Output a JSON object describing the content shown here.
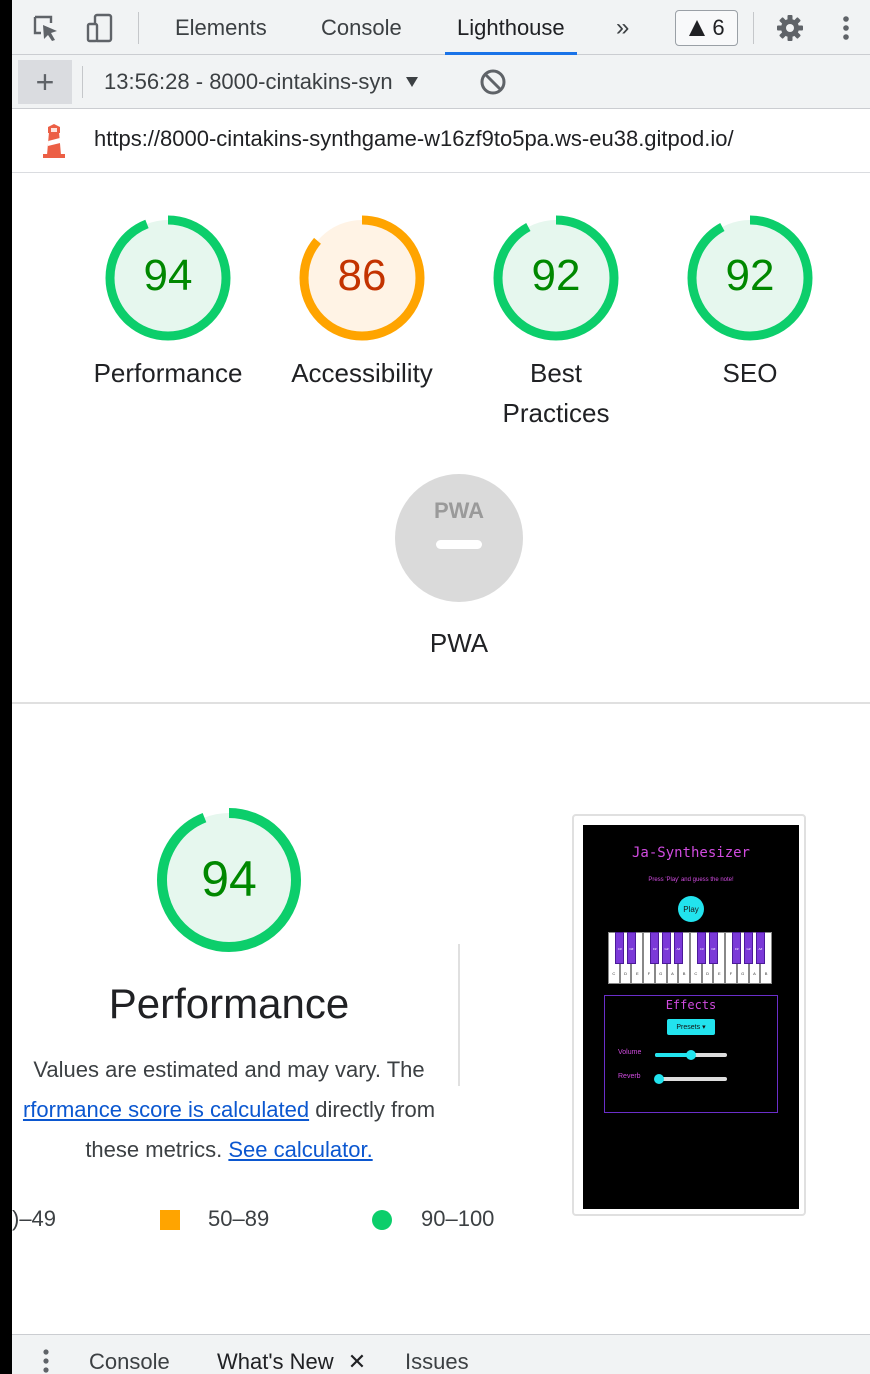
{
  "toolbar": {
    "tabs": [
      {
        "label": "Elements"
      },
      {
        "label": "Console"
      },
      {
        "label": "Lighthouse",
        "active": true
      }
    ],
    "overflow_icon": "chevron-double-right-icon",
    "warnings_count": "6",
    "settings_icon": "gear-icon",
    "more_icon": "vertical-dots-icon"
  },
  "toolbar2": {
    "new_report_label": "+",
    "report_select": "13:56:28 - 8000-cintakins-syn",
    "clear_icon": "block-icon"
  },
  "url_bar": {
    "icon": "lighthouse-icon",
    "url": "https://8000-cintakins-synthgame-w16zf9to5pa.ws-eu38.gitpod.io/"
  },
  "scores": [
    {
      "label": "Performance",
      "value": "94",
      "fraction": 0.94,
      "status": "pass"
    },
    {
      "label": "Accessibility",
      "value": "86",
      "fraction": 0.86,
      "status": "average"
    },
    {
      "label": "Best Practices",
      "line1": "Best",
      "line2": "Practices",
      "value": "92",
      "fraction": 0.92,
      "status": "pass"
    },
    {
      "label": "SEO",
      "value": "92",
      "fraction": 0.92,
      "status": "pass"
    }
  ],
  "pwa": {
    "badge": "PWA",
    "label": "PWA"
  },
  "performance": {
    "score": "94",
    "fraction": 0.94,
    "title": "Performance",
    "desc_part1": "Values are estimated and may vary. The",
    "desc_link1": "rformance score is calculated",
    "desc_part2": "directly from",
    "desc_part3": "these metrics.",
    "desc_link2": "See calculator."
  },
  "legend": {
    "fail_range": ")–49",
    "average_range": "50–89",
    "pass_range": "90–100"
  },
  "screenshot": {
    "title": "Ja-Synthesizer",
    "subtitle": "Press 'Play' and guess the note!",
    "play_label": "Play",
    "white_keys": [
      "C",
      "D",
      "E",
      "F",
      "G",
      "A",
      "B"
    ],
    "black_keys": [
      "C#",
      "D#",
      "F#",
      "G#",
      "A#"
    ],
    "effects_title": "Effects",
    "presets_label": "Presets ▾",
    "volume_label": "Volume",
    "volume_level": 0.5,
    "reverb_label": "Reverb",
    "reverb_level": 0.05
  },
  "drawer": {
    "more_icon": "vertical-dots-icon",
    "tabs": [
      {
        "label": "Console"
      },
      {
        "label": "What's New",
        "closable": true
      },
      {
        "label": "Issues"
      }
    ],
    "close_glyph": "✕"
  },
  "colors": {
    "pass": "#0cce6b",
    "pass_fill": "#e6f7ee",
    "pass_text": "#008800",
    "average": "#ffa400",
    "average_fill": "#fff3e5",
    "average_text": "#c33300",
    "pwa_fill": "#dadada",
    "link": "#0b57d0",
    "tab_underline": "#1a73e8"
  }
}
